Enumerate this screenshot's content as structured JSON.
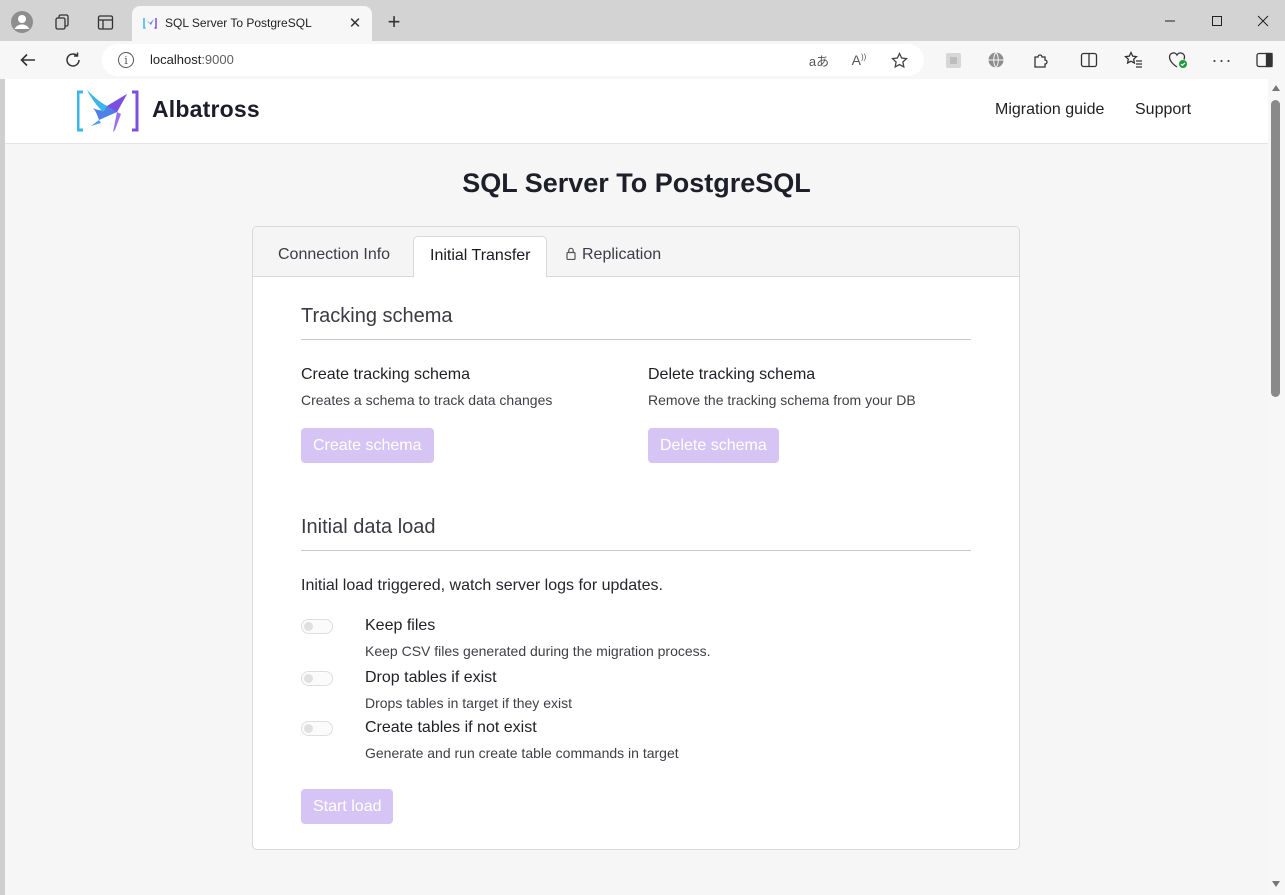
{
  "browser": {
    "tab_title": "SQL Server To PostgreSQL",
    "url_host": "localhost",
    "url_port": ":9000"
  },
  "site": {
    "brand": "Albatross",
    "nav": [
      "Migration guide",
      "Support"
    ]
  },
  "page": {
    "title": "SQL Server To PostgreSQL",
    "tabs": [
      {
        "label": "Connection Info",
        "active": false
      },
      {
        "label": "Initial Transfer",
        "active": true
      },
      {
        "label": "Replication",
        "active": false,
        "icon": "lock-icon"
      }
    ]
  },
  "tracking": {
    "title": "Tracking schema",
    "create": {
      "title": "Create tracking schema",
      "desc": "Creates a schema to track data changes",
      "button": "Create schema"
    },
    "delete": {
      "title": "Delete tracking schema",
      "desc": "Remove the tracking schema from your DB",
      "button": "Delete schema"
    }
  },
  "initial_load": {
    "title": "Initial data load",
    "status": "Initial load triggered, watch server logs for updates.",
    "options": [
      {
        "title": "Keep files",
        "desc": "Keep CSV files generated during the migration process.",
        "enabled": false
      },
      {
        "title": "Drop tables if exist",
        "desc": "Drops tables in target if they exist",
        "enabled": false
      },
      {
        "title": "Create tables if not exist",
        "desc": "Generate and run create table commands in target",
        "enabled": false
      }
    ],
    "button": "Start load"
  },
  "colors": {
    "accent_disabled": "#d6c4f5",
    "logo_blue": "#3ab6e8",
    "logo_purple": "#7b4fe0"
  }
}
